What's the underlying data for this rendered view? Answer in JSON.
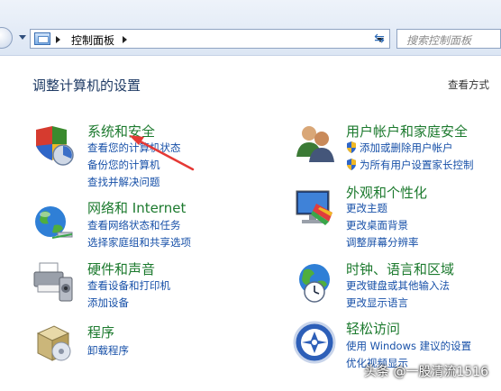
{
  "address_bar": {
    "crumb": "控制面板",
    "search_placeholder": "搜索控制面板"
  },
  "page": {
    "title": "调整计算机的设置",
    "view_by": "查看方式"
  },
  "categories": {
    "security": {
      "title": "系统和安全",
      "links": [
        "查看您的计算机状态",
        "备份您的计算机",
        "查找并解决问题"
      ]
    },
    "network": {
      "title": "网络和 Internet",
      "links": [
        "查看网络状态和任务",
        "选择家庭组和共享选项"
      ]
    },
    "hardware": {
      "title": "硬件和声音",
      "links": [
        "查看设备和打印机",
        "添加设备"
      ]
    },
    "programs": {
      "title": "程序",
      "links": [
        "卸载程序"
      ]
    },
    "users": {
      "title": "用户帐户和家庭安全",
      "links": [
        "添加或删除用户帐户",
        "为所有用户设置家长控制"
      ]
    },
    "appearance": {
      "title": "外观和个性化",
      "links": [
        "更改主题",
        "更改桌面背景",
        "调整屏幕分辨率"
      ]
    },
    "clock": {
      "title": "时钟、语言和区域",
      "links": [
        "更改键盘或其他输入法",
        "更改显示语言"
      ]
    },
    "ease": {
      "title": "轻松访问",
      "links": [
        "使用 Windows 建议的设置",
        "优化视频显示"
      ]
    }
  },
  "watermark": "头条 @一股清流1516",
  "colors": {
    "category_title": "#1c7a2e",
    "link": "#1750a8",
    "annotation_arrow": "#e53935"
  }
}
